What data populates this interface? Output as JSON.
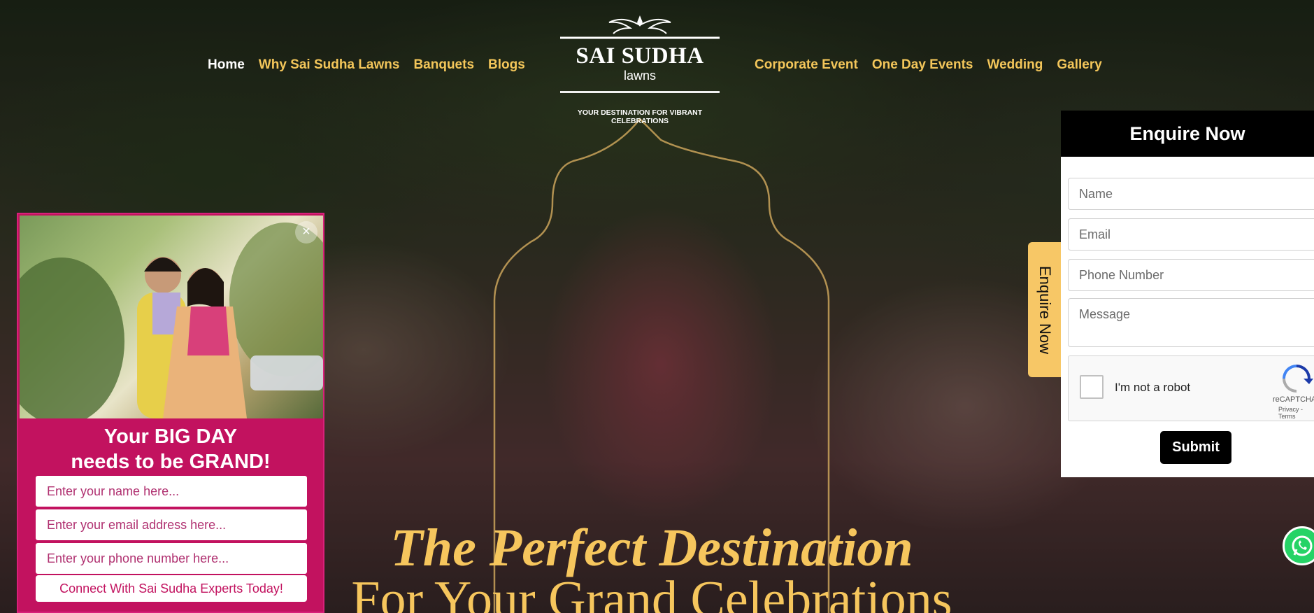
{
  "nav": {
    "left": [
      "Home",
      "Why Sai Sudha Lawns",
      "Banquets",
      "Blogs"
    ],
    "right": [
      "Corporate Event",
      "One Day Events",
      "Wedding",
      "Gallery"
    ],
    "active": "Home"
  },
  "logo": {
    "title": "SAI SUDHA",
    "subtitle": "lawns",
    "tagline": "YOUR DESTINATION FOR VIBRANT CELEBRATIONS"
  },
  "hero": {
    "line1": "The Perfect Destination",
    "line2": "For Your Grand Celebrations"
  },
  "popup": {
    "close_icon": "close-icon",
    "heading_line1": "Your BIG DAY",
    "heading_line2": "needs to be GRAND!",
    "name_placeholder": "Enter your name here...",
    "email_placeholder": "Enter your email address here...",
    "phone_placeholder": "Enter your phone number here...",
    "button_label": "Connect With Sai Sudha Experts Today!"
  },
  "enquire": {
    "tab_label": "Enquire Now",
    "title": "Enquire Now",
    "name_placeholder": "Name",
    "email_placeholder": "Email",
    "phone_placeholder": "Phone Number",
    "message_placeholder": "Message",
    "captcha_label": "I'm not a robot",
    "captcha_brand": "reCAPTCHA",
    "captcha_links": "Privacy - Terms",
    "submit_label": "Submit"
  },
  "colors": {
    "nav_link": "#f3c65a",
    "nav_active": "#ffffff",
    "hero_gold": "#f6c65d",
    "popup_bg": "#c2125f",
    "enquire_tab": "#f7c766",
    "whatsapp": "#25d366"
  },
  "icons": {
    "whatsapp": "whatsapp-icon",
    "recaptcha": "recaptcha-icon"
  }
}
